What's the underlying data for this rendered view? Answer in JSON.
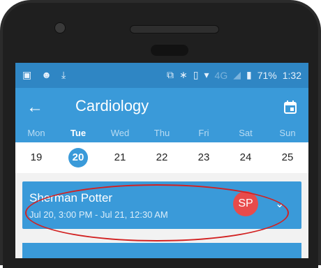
{
  "status_bar": {
    "battery": "71%",
    "time": "1:32",
    "network": "4G"
  },
  "toolbar": {
    "title": "Cardiology"
  },
  "week": {
    "days": [
      "Mon",
      "Tue",
      "Wed",
      "Thu",
      "Fri",
      "Sat",
      "Sun"
    ],
    "dates": [
      "19",
      "20",
      "21",
      "22",
      "23",
      "24",
      "25"
    ],
    "selected_index": 1
  },
  "appointment": {
    "patient_name": "Sherman Potter",
    "time_range": "Jul 20, 3:00 PM - Jul 21, 12:30 AM",
    "initials": "SP"
  },
  "icons": {
    "back": "arrow-left-icon",
    "calendar": "calendar-icon",
    "expand": "chevron-down-icon"
  },
  "colors": {
    "primary": "#3a9ad9",
    "status_bar": "#2f86c4",
    "avatar": "#e84b4b",
    "highlight": "#d22121"
  }
}
